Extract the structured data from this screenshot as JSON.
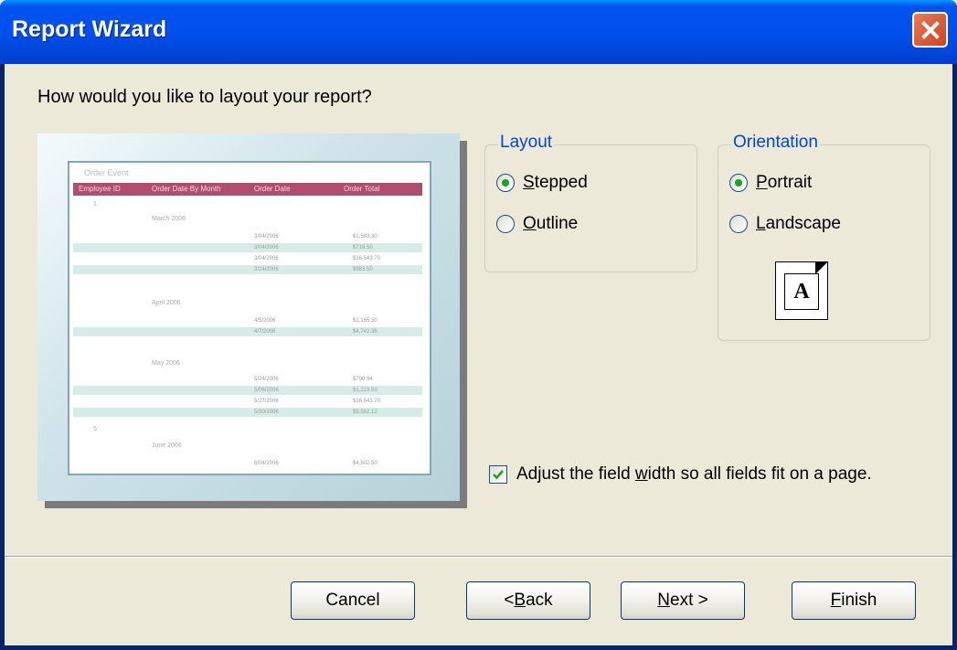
{
  "window": {
    "title": "Report Wizard"
  },
  "question": "How would you like to layout your report?",
  "preview": {
    "report_title": "Order Event",
    "headers": [
      "Employee ID",
      "Order Date By Month",
      "Order Date",
      "Order Total"
    ],
    "groups": [
      {
        "id": "1",
        "month": "March 2006"
      },
      {
        "month": "April 2006"
      },
      {
        "month": "May 2006"
      },
      {
        "id": "5",
        "month": "June 2006"
      }
    ],
    "rows": [
      {
        "date": "3/04/2006",
        "total": "$1,593.30"
      },
      {
        "date": "3/04/2006",
        "total": "$719.50"
      },
      {
        "date": "3/04/2006",
        "total": "$16,543.70"
      },
      {
        "date": "3/24/2006",
        "total": "$983.50"
      },
      {
        "date": "4/5/2006",
        "total": "$1,165.30"
      },
      {
        "date": "4/7/2006",
        "total": "$4,742.36"
      },
      {
        "date": "5/24/2006",
        "total": "$790.94"
      },
      {
        "date": "5/06/2006",
        "total": "$1,219.50"
      },
      {
        "date": "5/27/2006",
        "total": "$16,543.70"
      },
      {
        "date": "5/30/2006",
        "total": "$5,562.12"
      },
      {
        "date": "6/04/2006",
        "total": "$4,502.50"
      }
    ]
  },
  "layout": {
    "legend": "Layout",
    "options": [
      {
        "label": "Stepped",
        "mnemonic": "S",
        "rest": "tepped",
        "selected": true
      },
      {
        "label": "Outline",
        "mnemonic": "O",
        "rest": "utline",
        "selected": false
      }
    ]
  },
  "orientation": {
    "legend": "Orientation",
    "options": [
      {
        "label": "Portrait",
        "mnemonic": "P",
        "rest": "ortrait",
        "selected": true
      },
      {
        "label": "Landscape",
        "mnemonic": "L",
        "rest": "andscape",
        "selected": false
      }
    ],
    "icon_letter": "A"
  },
  "adjust_width": {
    "checked": true,
    "pre": "Adjust the field ",
    "mnemonic": "w",
    "post": "idth so all fields fit on a page."
  },
  "buttons": {
    "cancel": "Cancel",
    "back_pre": "< ",
    "back_mn": "B",
    "back_rest": "ack",
    "next_mn": "N",
    "next_rest": "ext >",
    "finish_mn": "F",
    "finish_rest": "inish"
  }
}
